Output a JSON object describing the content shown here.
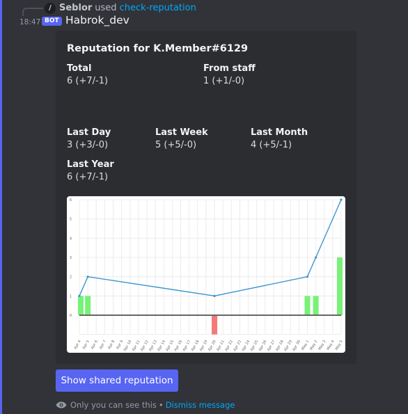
{
  "reply": {
    "slash_glyph": "/",
    "user": "Seblor",
    "verb": "used",
    "command": "check-reputation"
  },
  "message": {
    "timestamp": "18:47",
    "bot_tag": "BOT",
    "author": "Habrok_dev"
  },
  "embed": {
    "title": "Reputation for K.Member#6129",
    "fields": {
      "total": {
        "name": "Total",
        "value": "6 (+7/-1)"
      },
      "from_staff": {
        "name": "From staff",
        "value": "1 (+1/-0)"
      },
      "last_day": {
        "name": "Last Day",
        "value": "3 (+3/-0)"
      },
      "last_week": {
        "name": "Last Week",
        "value": "5 (+5/-0)"
      },
      "last_month": {
        "name": "Last Month",
        "value": "4 (+5/-1)"
      },
      "last_year": {
        "name": "Last Year",
        "value": "6 (+7/-1)"
      }
    }
  },
  "chart_data": {
    "type": "bar",
    "categories": [
      "Apr 4",
      "Apr 5",
      "Apr 6",
      "Apr 7",
      "Apr 8",
      "Apr 9",
      "Apr 10",
      "Apr 11",
      "Apr 12",
      "Apr 13",
      "Apr 14",
      "Apr 15",
      "Apr 16",
      "Apr 17",
      "Apr 18",
      "Apr 19",
      "Apr 20",
      "Apr 21",
      "Apr 22",
      "Apr 23",
      "Apr 24",
      "Apr 25",
      "Apr 26",
      "Apr 27",
      "Apr 28",
      "Apr 29",
      "Apr 30",
      "May 1",
      "May 2",
      "May 3",
      "May 4",
      "May 5"
    ],
    "series": [
      {
        "values": [
          1,
          1,
          0,
          0,
          0,
          0,
          0,
          0,
          0,
          0,
          0,
          0,
          0,
          0,
          0,
          0,
          -1,
          0,
          0,
          0,
          0,
          0,
          0,
          0,
          0,
          0,
          0,
          1,
          1,
          0,
          0,
          3
        ]
      },
      {
        "type": "line",
        "points": [
          [
            "Apr 4",
            1
          ],
          [
            "Apr 5",
            2
          ],
          [
            "Apr 20",
            1
          ],
          [
            "May 1",
            2
          ],
          [
            "May 2",
            3
          ],
          [
            "May 5",
            6
          ]
        ]
      }
    ],
    "yticks": [
      0,
      1,
      2,
      3,
      4,
      5,
      6
    ],
    "ylim": [
      -1,
      6
    ],
    "grid": true,
    "colors": {
      "positive": "#77f277",
      "negative": "#f47a7a",
      "line": "#3e95cd",
      "zero_line": "#666666"
    }
  },
  "button": {
    "label": "Show shared reputation"
  },
  "footer": {
    "eye_icon": "eye-icon",
    "note": "Only you can see this",
    "separator": "•",
    "dismiss": "Dismiss message"
  }
}
